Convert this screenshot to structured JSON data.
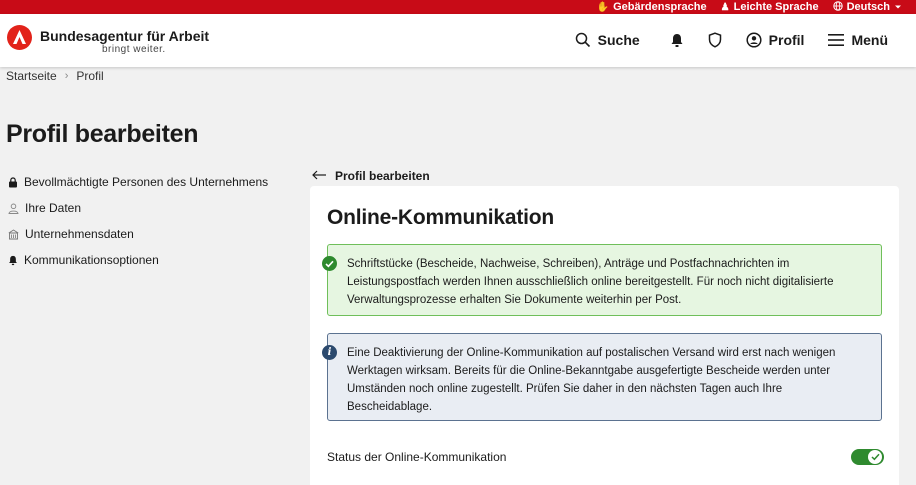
{
  "topbar": {
    "links": [
      {
        "label": "Gebärdensprache",
        "icon": "sign-language-icon"
      },
      {
        "label": "Leichte Sprache",
        "icon": "easy-language-icon"
      },
      {
        "label": "Deutsch",
        "icon": "globe-icon"
      }
    ]
  },
  "header": {
    "brand_name": "Bundesagentur für Arbeit",
    "brand_tagline": "bringt weiter.",
    "nav": {
      "search_label": "Suche",
      "profile_label": "Profil",
      "menu_label": "Menü"
    }
  },
  "breadcrumb": {
    "items": [
      "Startseite",
      "Profil"
    ],
    "separator": "›"
  },
  "page": {
    "title": "Profil bearbeiten"
  },
  "sidebar": {
    "items": [
      {
        "label": "Bevollmächtigte Personen des Unternehmens",
        "icon": "lock-icon"
      },
      {
        "label": "Ihre Daten",
        "icon": "person-icon"
      },
      {
        "label": "Unternehmensdaten",
        "icon": "building-icon"
      },
      {
        "label": "Kommunikationsoptionen",
        "icon": "bell-icon"
      }
    ]
  },
  "main": {
    "back_label": "Profil bearbeiten",
    "card_title": "Online-Kommunikation",
    "success_text": "Schriftstücke (Bescheide, Nachweise, Schreiben), Anträge und Postfachnachrichten im Leistungspostfach werden Ihnen ausschließlich online bereitgestellt. Für noch nicht digitalisierte Verwaltungsprozesse erhalten Sie Dokumente weiterhin per Post.",
    "info_text": "Eine Deaktivierung der Online-Kommunikation auf postalischen Versand wird erst nach wenigen Werktagen wirksam. Bereits für die Online-Bekanntgabe ausgefertigte Bescheide werden unter Umständen noch online zugestellt. Prüfen Sie daher in den nächsten Tagen auch Ihre Bescheidablage.",
    "status_label": "Status der Online-Kommunikation",
    "status_enabled": true
  },
  "colors": {
    "brand_red": "#c80b17",
    "success_bg": "#e6f6e1",
    "success_border": "#6fbf5a",
    "info_bg": "#e9edf3",
    "info_border": "#5b7290",
    "toggle_on": "#2f8a2f"
  }
}
